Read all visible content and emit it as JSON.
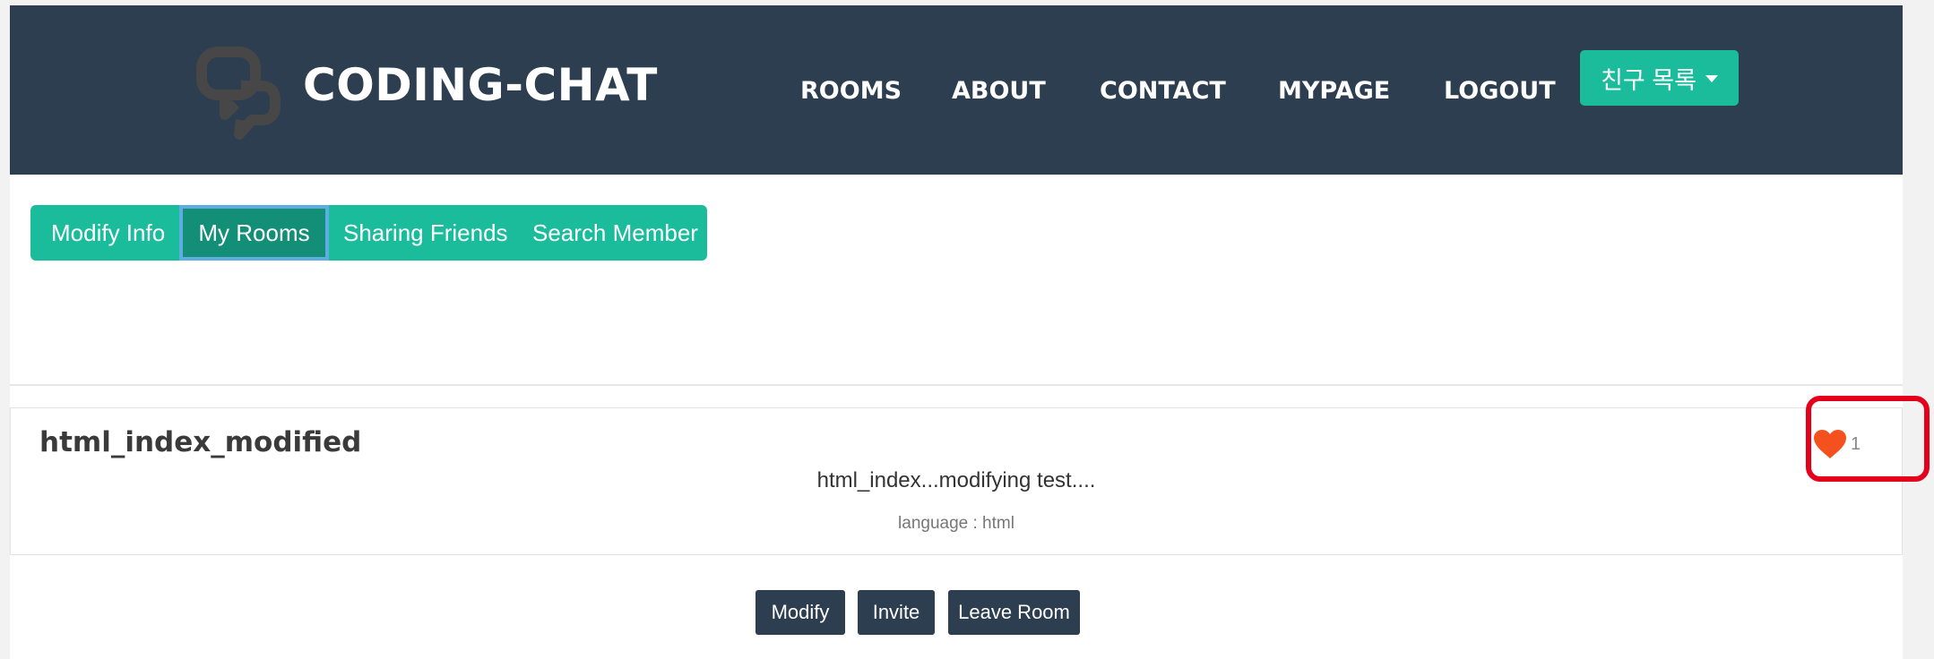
{
  "brand": {
    "name": "CODING-CHAT"
  },
  "nav": {
    "items": [
      "ROOMS",
      "ABOUT",
      "CONTACT",
      "MYPAGE",
      "LOGOUT"
    ],
    "friends_label": "친구 목록"
  },
  "tabs": {
    "items": [
      "Modify Info",
      "My Rooms",
      "Sharing Friends",
      "Search Member"
    ],
    "active": "My Rooms"
  },
  "room": {
    "title": "html_index_modified",
    "description": "html_index...modifying test....",
    "language": "language : html",
    "likes": "1"
  },
  "actions": {
    "modify_label": "Modify",
    "invite_label": "Invite",
    "leave_label": "Leave Room"
  },
  "colors": {
    "navbar": "#2c3e50",
    "accent": "#1abc9c",
    "active_tab": "#148f77",
    "active_tab_border": "#5dade2",
    "heart": "#f4511e",
    "highlight": "#e4001b"
  },
  "icons": {
    "brand": "chat-bubbles-icon",
    "like": "heart-icon",
    "dropdown": "caret-down-icon"
  }
}
